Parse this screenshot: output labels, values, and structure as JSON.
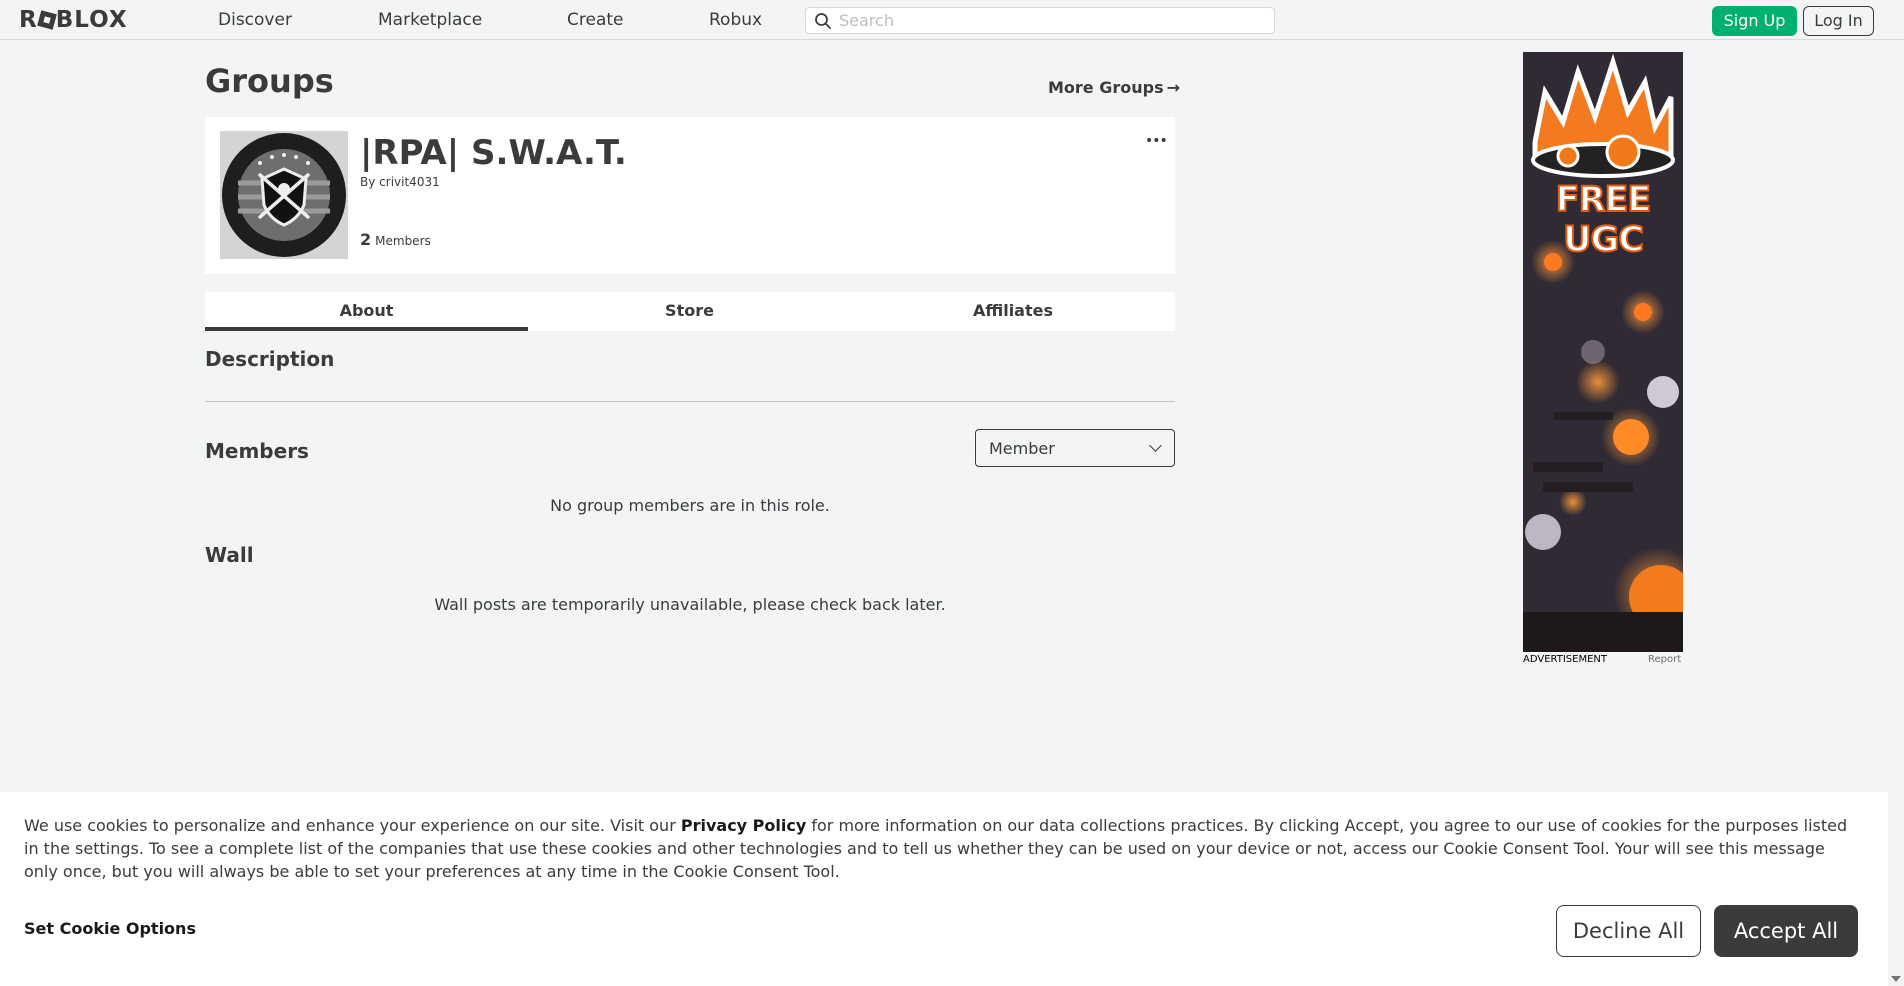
{
  "nav": {
    "logo": "ROBLOX",
    "items": [
      "Discover",
      "Marketplace",
      "Create",
      "Robux"
    ],
    "search_placeholder": "Search",
    "signup_label": "Sign Up",
    "login_label": "Log In"
  },
  "page": {
    "title": "Groups",
    "more_groups": "More Groups"
  },
  "group": {
    "name": "|RPA| S.W.A.T.",
    "by_label": "By",
    "owner": "crivit4031",
    "member_count": "2",
    "members_label": "Members",
    "more_label": "•••"
  },
  "tabs": [
    {
      "label": "About",
      "active": true
    },
    {
      "label": "Store",
      "active": false
    },
    {
      "label": "Affiliates",
      "active": false
    }
  ],
  "sections": {
    "description": "Description",
    "members": "Members",
    "role_selected": "Member",
    "no_members": "No group members are in this role.",
    "wall": "Wall",
    "wall_unavailable": "Wall posts are temporarily unavailable, please check back later."
  },
  "ad": {
    "headline": "FREE UGC",
    "label": "ADVERTISEMENT",
    "report": "Report"
  },
  "cookie": {
    "text_before": "We use cookies to personalize and enhance your experience on our site. Visit our ",
    "link": "Privacy Policy",
    "text_after": " for more information on our data collections practices. By clicking Accept, you agree to our use of cookies for the purposes listed in the settings. To see a complete list of the companies that use these cookies and other technologies and to tell us whether they can be used on your device or not, access our Cookie Consent Tool. Your will see this message only once, but you will always be able to set your preferences at any time in the Cookie Consent Tool.",
    "set_options": "Set Cookie Options",
    "decline": "Decline All",
    "accept": "Accept All"
  },
  "colors": {
    "signup_green": "#00b06f",
    "text_dark": "#393b3d",
    "background": "#f2f4f5"
  }
}
